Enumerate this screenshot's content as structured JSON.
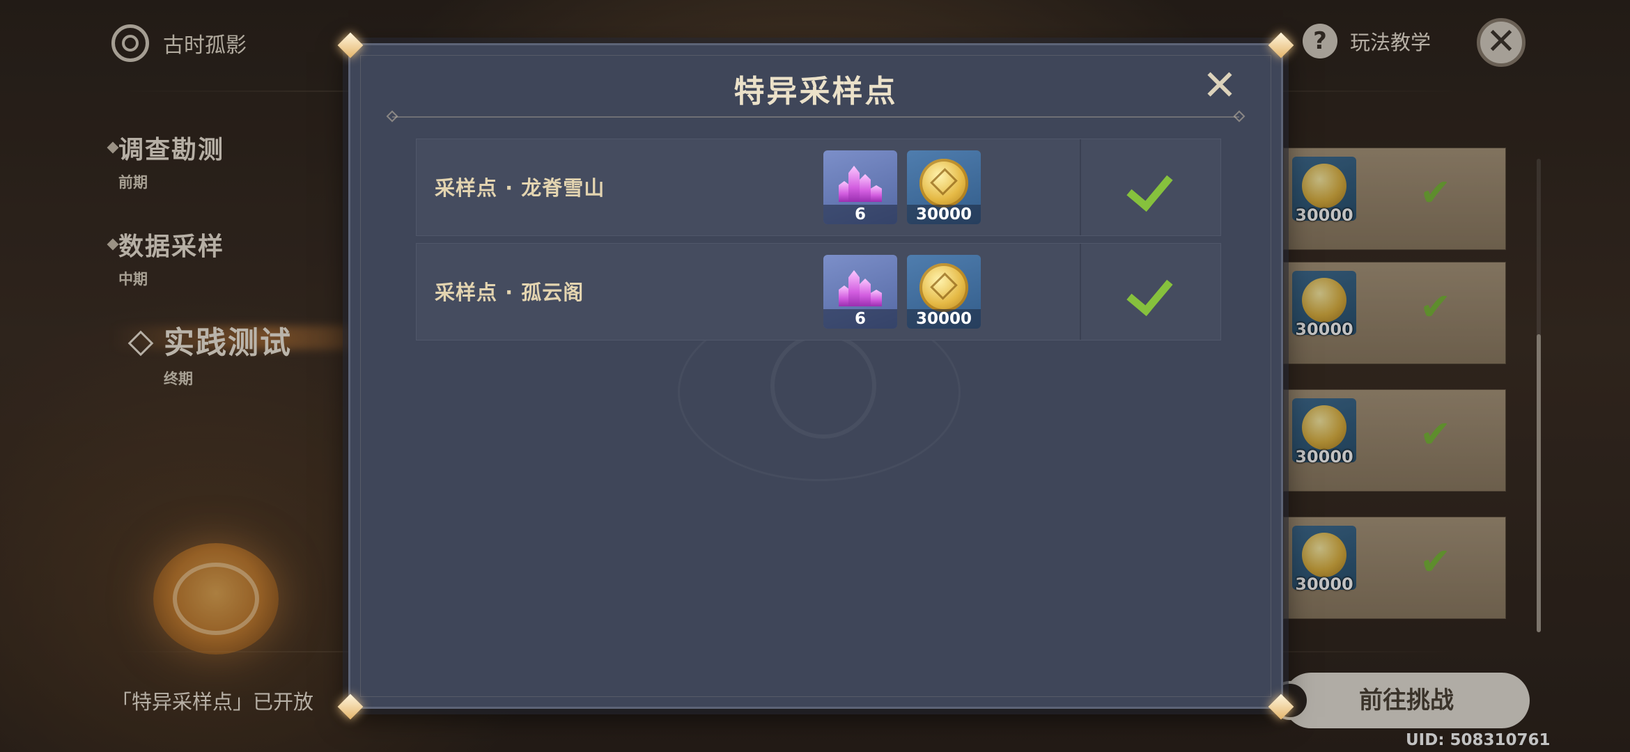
{
  "background": {
    "event_title": "古时孤影",
    "stages": [
      {
        "title": "调查勘测",
        "sub": "前期"
      },
      {
        "title": "数据采样",
        "sub": "中期"
      },
      {
        "title": "实践测试",
        "sub": "终期"
      }
    ],
    "notice": "「特异采样点」已开放",
    "help_label": "玩法教学",
    "reward_amounts": [
      "30000",
      "30000",
      "30000",
      "30000"
    ],
    "go_button": "前往挑战",
    "uid": "UID: 508310761"
  },
  "modal": {
    "title": "特异采样点",
    "rows": [
      {
        "name": "采样点 · 龙脊雪山",
        "crystal_count": "6",
        "mora_count": "30000",
        "claimed": true
      },
      {
        "name": "采样点 · 孤云阁",
        "crystal_count": "6",
        "mora_count": "30000",
        "claimed": true
      }
    ]
  },
  "icons": {
    "close": "close-icon",
    "help": "question-icon",
    "check": "check-icon",
    "crystal": "crystal-icon",
    "mora": "mora-coin-icon"
  },
  "colors": {
    "modal_bg": "#3f4659",
    "check_green": "#86c13d",
    "title_gold": "#ebe1c9"
  }
}
